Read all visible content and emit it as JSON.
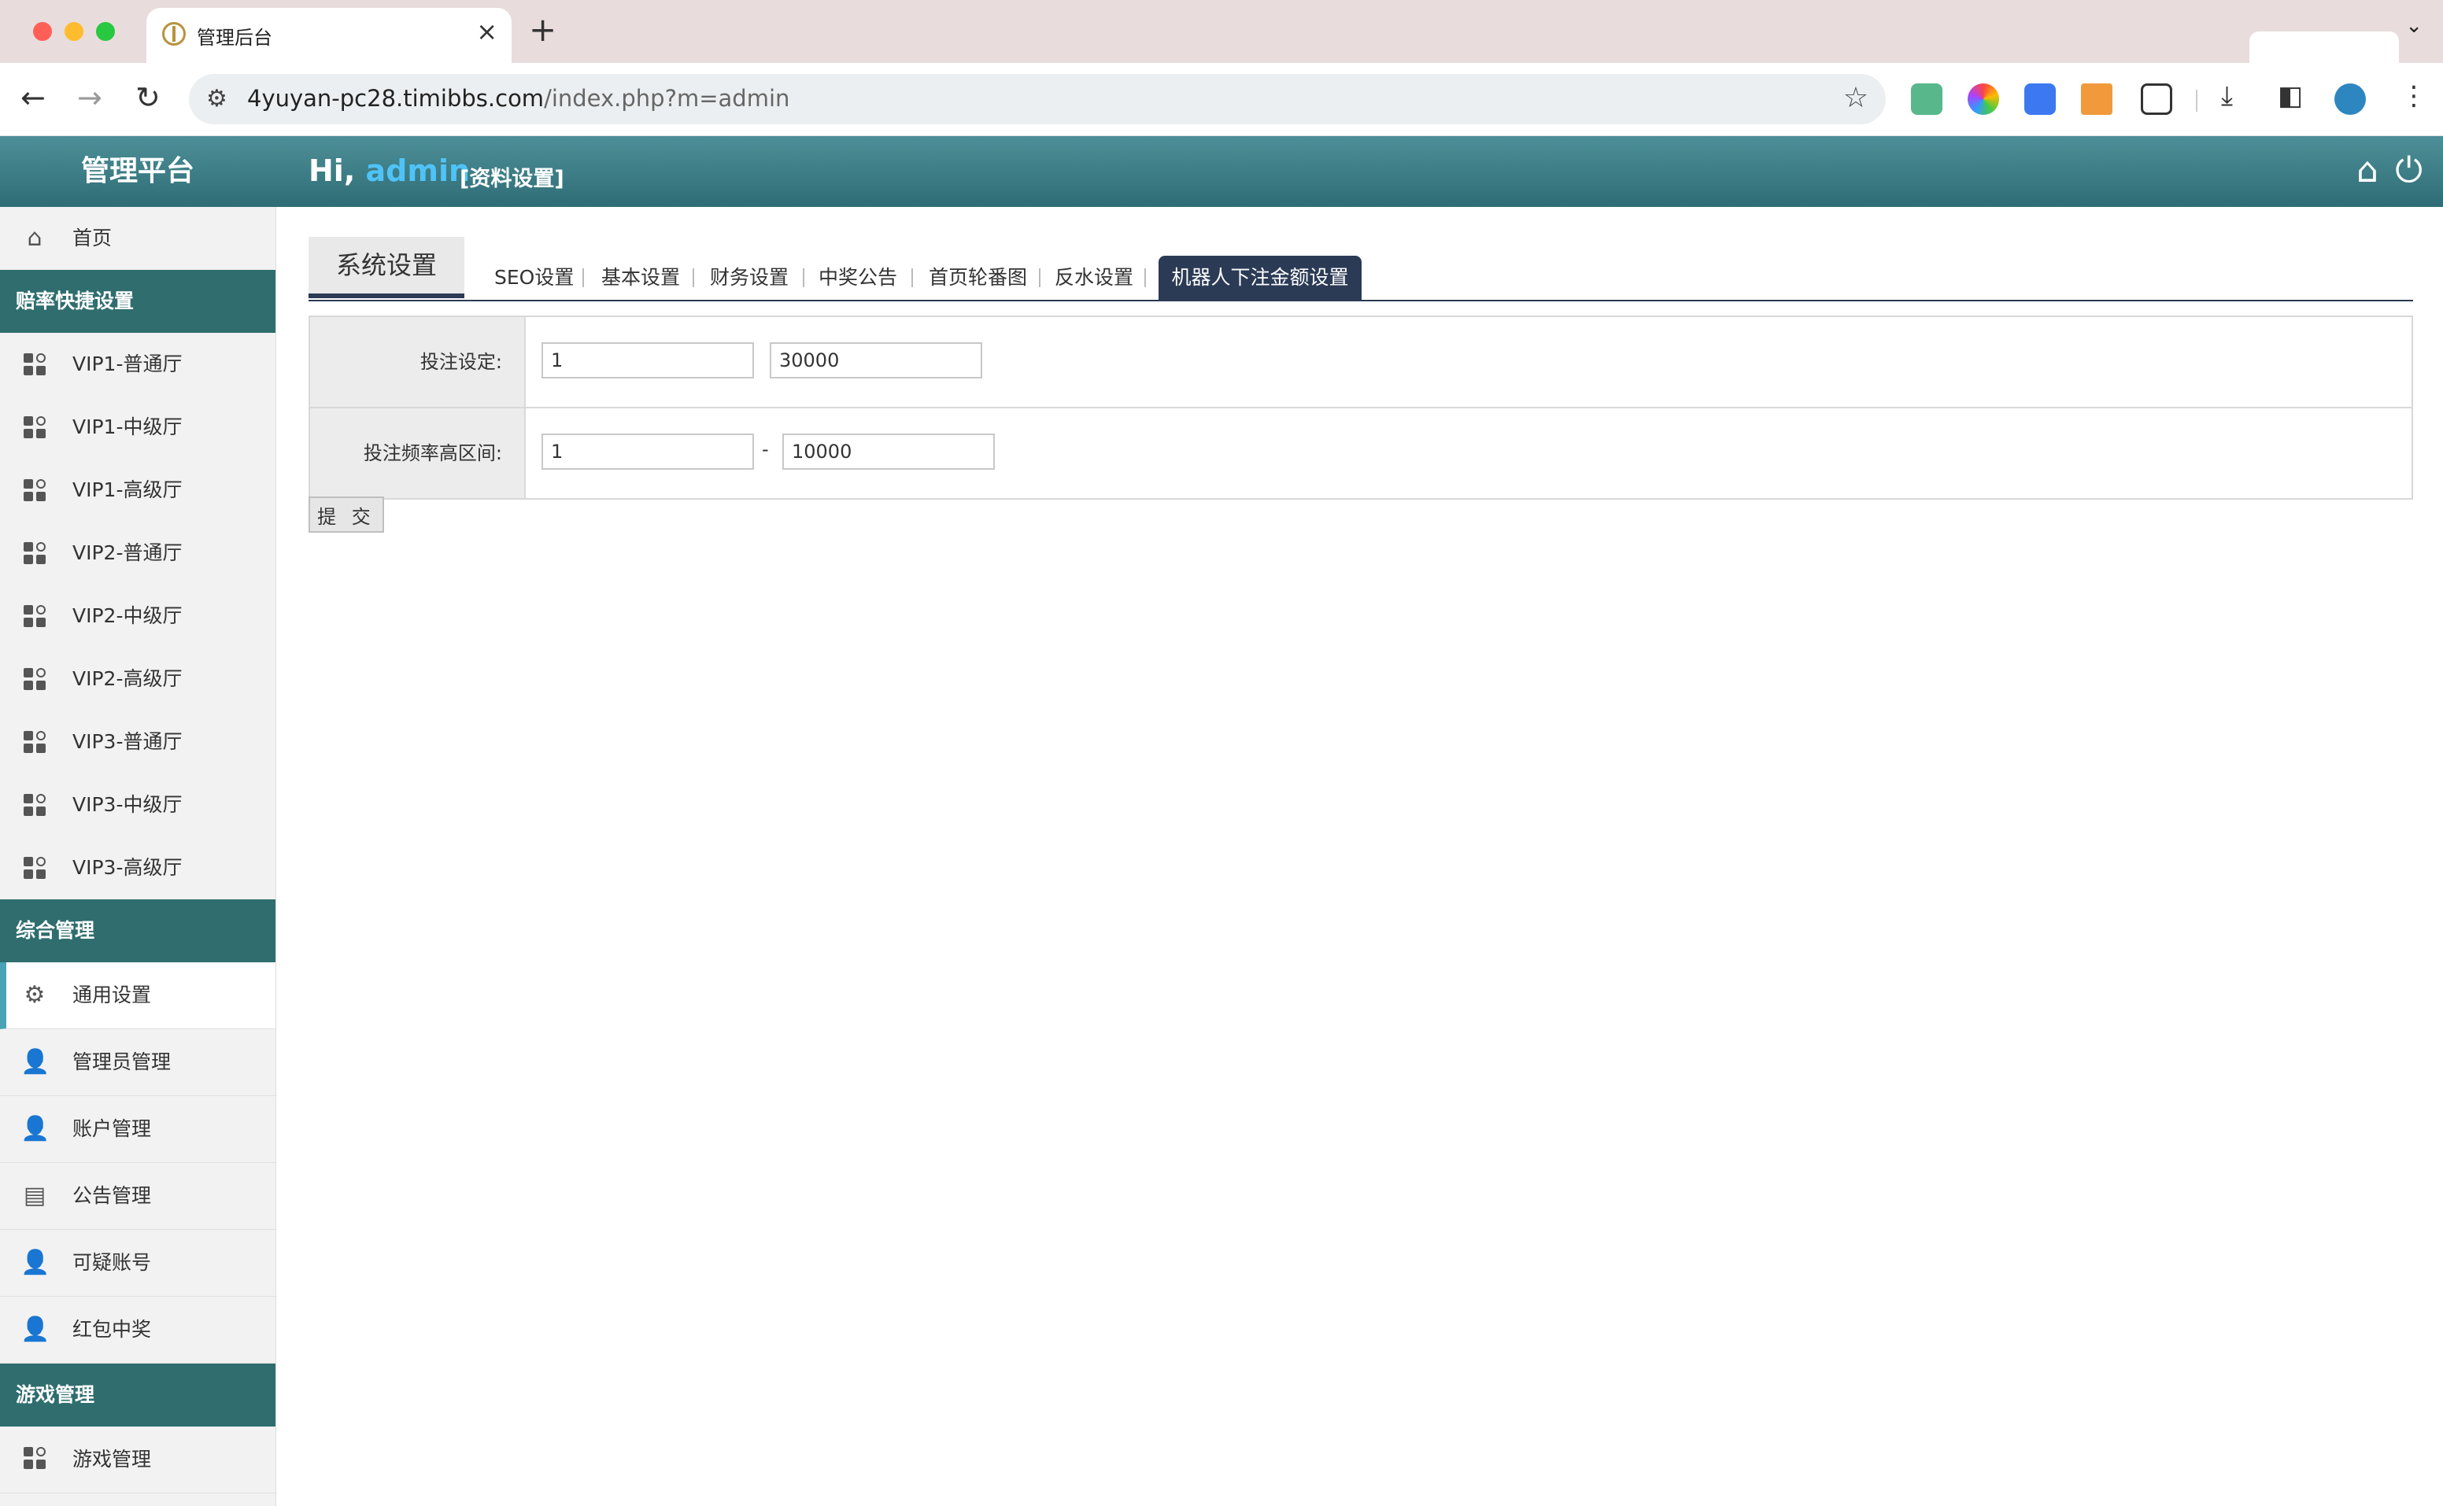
{
  "browser": {
    "tab_title": "管理后台",
    "url_host": "4yuyan-pc28.timibbs.com",
    "url_path": "/index.php?m=admin"
  },
  "header": {
    "brand": "管理平台",
    "greeting_prefix": "Hi,",
    "username": "admin",
    "profile_link": "[资料设置]"
  },
  "sidebar": {
    "home": "首页",
    "section_odds": "赔率快捷设置",
    "odds_items": [
      "VIP1-普通厅",
      "VIP1-中级厅",
      "VIP1-高级厅",
      "VIP2-普通厅",
      "VIP2-中级厅",
      "VIP2-高级厅",
      "VIP3-普通厅",
      "VIP3-中级厅",
      "VIP3-高级厅"
    ],
    "section_general": "综合管理",
    "general_items": [
      "通用设置",
      "管理员管理",
      "账户管理",
      "公告管理",
      "可疑账号",
      "红包中奖"
    ],
    "section_games": "游戏管理",
    "game_items": [
      "游戏管理"
    ]
  },
  "main": {
    "section_tab": "系统设置",
    "tabs": [
      "SEO设置",
      "基本设置",
      "财务设置",
      "中奖公告",
      "首页轮番图",
      "反水设置"
    ],
    "active_tab": "机器人下注金额设置",
    "form": {
      "bet_label": "投注设定:",
      "bet_min": "1",
      "bet_max": "30000",
      "freq_label": "投注频率高区间:",
      "freq_min": "1",
      "freq_dash": "-",
      "freq_max": "10000"
    },
    "submit_label": "提 交"
  }
}
